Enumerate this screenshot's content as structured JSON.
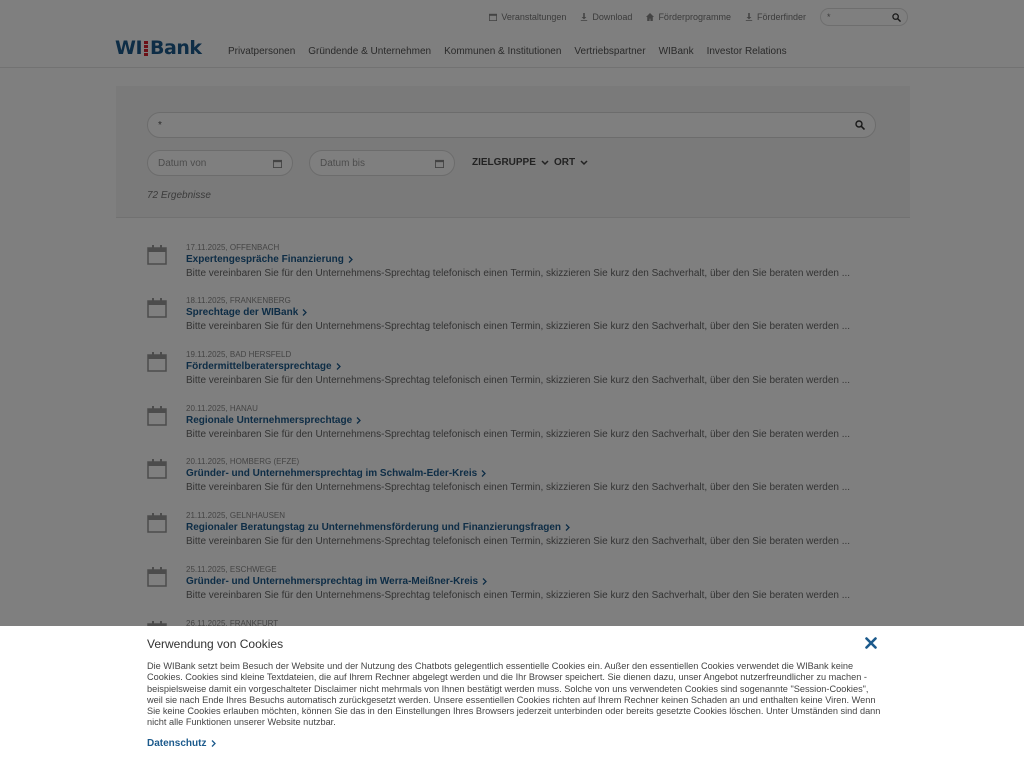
{
  "header": {
    "util_links": [
      {
        "label": "Veranstaltungen",
        "icon": "calendar-icon"
      },
      {
        "label": "Download",
        "icon": "download-icon"
      },
      {
        "label": "Förderprogramme",
        "icon": "home-icon"
      },
      {
        "label": "Förderfinder",
        "icon": "download-icon"
      }
    ],
    "search_value": "*",
    "logo_left": "WI",
    "logo_right": "Bank",
    "nav": [
      "Privatpersonen",
      "Gründende & Unternehmen",
      "Kommunen & Institutionen",
      "Vertriebspartner",
      "WIBank",
      "Investor Relations"
    ]
  },
  "filters": {
    "search_value": "*",
    "date_from_placeholder": "Datum von",
    "date_to_placeholder": "Datum bis",
    "target_group": "ZIELGRUPPE",
    "location": "ORT",
    "results": "72 Ergebnisse"
  },
  "events": [
    {
      "meta": "17.11.2025, OFFENBACH",
      "title": "Expertengespräche Finanzierung",
      "desc": "Bitte vereinbaren Sie für den Unternehmens-Sprechtag telefonisch einen Termin, skizzieren Sie kurz den Sachverhalt, über den Sie beraten werden ..."
    },
    {
      "meta": "18.11.2025, FRANKENBERG",
      "title": "Sprechtage der WIBank",
      "desc": "Bitte vereinbaren Sie für den Unternehmens-Sprechtag telefonisch einen Termin, skizzieren Sie kurz den Sachverhalt, über den Sie beraten werden ..."
    },
    {
      "meta": "19.11.2025, BAD HERSFELD",
      "title": "Fördermittelberatersprechtage",
      "desc": "Bitte vereinbaren Sie für den Unternehmens-Sprechtag telefonisch einen Termin, skizzieren Sie kurz den Sachverhalt, über den Sie beraten werden ..."
    },
    {
      "meta": "20.11.2025, HANAU",
      "title": "Regionale Unternehmersprechtage",
      "desc": "Bitte vereinbaren Sie für den Unternehmens-Sprechtag telefonisch einen Termin, skizzieren Sie kurz den Sachverhalt, über den Sie beraten werden ..."
    },
    {
      "meta": "20.11.2025, HOMBERG (EFZE)",
      "title": "Gründer- und Unternehmersprechtag im Schwalm-Eder-Kreis",
      "desc": "Bitte vereinbaren Sie für den Unternehmens-Sprechtag telefonisch einen Termin, skizzieren Sie kurz den Sachverhalt, über den Sie beraten werden ..."
    },
    {
      "meta": "21.11.2025, GELNHAUSEN",
      "title": "Regionaler Beratungstag zu Unternehmensförderung und Finanzierungsfragen",
      "desc": "Bitte vereinbaren Sie für den Unternehmens-Sprechtag telefonisch einen Termin, skizzieren Sie kurz den Sachverhalt, über den Sie beraten werden ..."
    },
    {
      "meta": "25.11.2025, ESCHWEGE",
      "title": "Gründer- und Unternehmersprechtag im Werra-Meißner-Kreis",
      "desc": "Bitte vereinbaren Sie für den Unternehmens-Sprechtag telefonisch einen Termin, skizzieren Sie kurz den Sachverhalt, über den Sie beraten werden ..."
    },
    {
      "meta": "26.11.2025, FRANKFURT",
      "title": "",
      "desc": ""
    }
  ],
  "cookie": {
    "title": "Verwendung von Cookies",
    "text": "Die WIBank setzt beim Besuch der Website und der Nutzung des Chatbots gelegentlich essentielle Cookies ein. Außer den essentiellen Cookies verwendet die WIBank keine Cookies. Cookies sind kleine Textdateien, die auf Ihrem Rechner abgelegt werden und die Ihr Browser speichert. Sie dienen dazu, unser Angebot nutzerfreundlicher zu machen - beispielsweise damit ein vorgeschalteter Disclaimer nicht mehrmals von Ihnen bestätigt werden muss. Solche von uns verwendeten Cookies sind sogenannte \"Session-Cookies\", weil sie nach Ende Ihres Besuchs automatisch zurückgesetzt werden. Unsere essentiellen Cookies richten auf Ihrem Rechner keinen Schaden an und enthalten keine Viren. Wenn Sie keine Cookies erlauben möchten, können Sie das in den Einstellungen Ihres Browsers jederzeit unterbinden oder bereits gesetzte Cookies löschen. Unter Umständen sind dann nicht alle Funktionen unserer Website nutzbar.",
    "link": "Datenschutz"
  },
  "colors": {
    "brand_blue": "#1c5a8c",
    "brand_red": "#d9232e",
    "overlay": "rgba(0,0,0,0.5)"
  }
}
